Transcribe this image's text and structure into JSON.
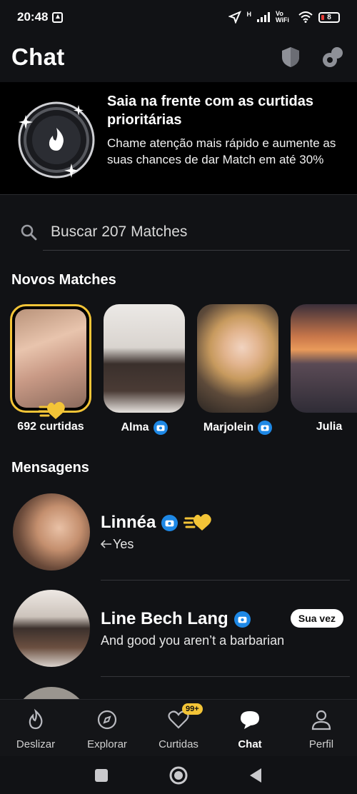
{
  "status_bar": {
    "time": "20:48",
    "network": "H",
    "volte": "Vo WiFi",
    "battery": "8"
  },
  "header": {
    "title": "Chat"
  },
  "promo": {
    "title": "Saia na frente com as curtidas prioritárias",
    "body": "Chame atenção mais rápido e aumente as suas chances de dar Match em até 30%"
  },
  "search": {
    "placeholder": "Buscar 207 Matches"
  },
  "new_matches": {
    "title": "Novos Matches",
    "items": [
      {
        "label": "692 curtidas",
        "verified": false
      },
      {
        "label": "Alma",
        "verified": true
      },
      {
        "label": "Marjolein",
        "verified": true
      },
      {
        "label": "Julia",
        "verified": false
      }
    ]
  },
  "messages": {
    "title": "Mensagens",
    "items": [
      {
        "name": "Linnéa",
        "preview": "Yes",
        "verified": true,
        "replied": true
      },
      {
        "name": "Line Bech Lang",
        "preview": "And good you aren’t a barbarian",
        "verified": true,
        "badge": "Sua vez"
      }
    ]
  },
  "bottom_nav": {
    "items": [
      {
        "label": "Deslizar",
        "icon": "flame-icon"
      },
      {
        "label": "Explorar",
        "icon": "compass-icon"
      },
      {
        "label": "Curtidas",
        "icon": "heart-icon",
        "badge": "99+"
      },
      {
        "label": "Chat",
        "icon": "chat-bubble-icon",
        "active": true
      },
      {
        "label": "Perfil",
        "icon": "person-icon"
      }
    ]
  },
  "colors": {
    "background": "#111215",
    "accent_gold": "#f3c437",
    "verified_blue": "#1e88e5"
  }
}
